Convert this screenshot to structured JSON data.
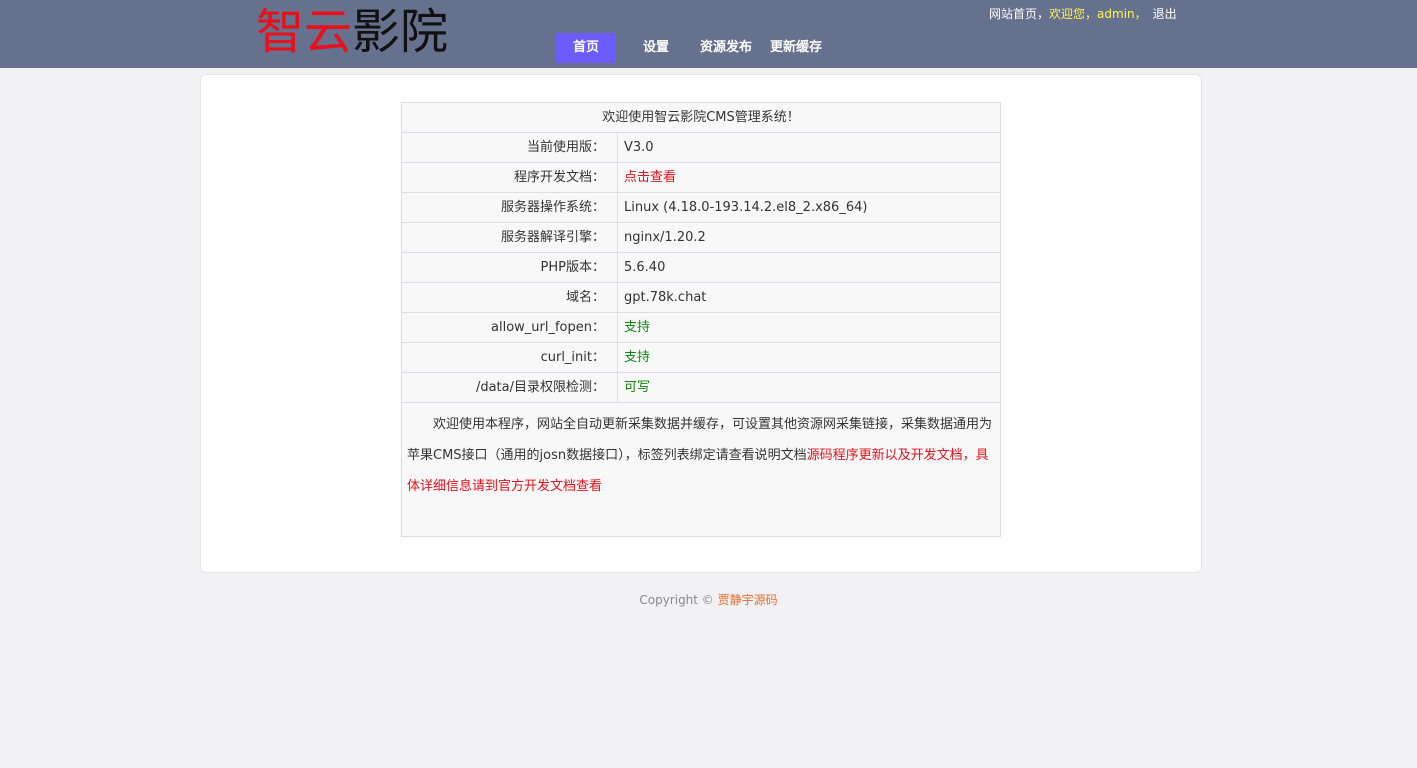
{
  "header": {
    "logo_part1": "智云",
    "logo_part2": "影院",
    "top_links": {
      "home": "网站首页，",
      "welcome": "欢迎您，",
      "user": "admin",
      "sep": "，",
      "logout": "退出"
    },
    "nav": [
      {
        "label": "首页"
      },
      {
        "label": "设置"
      },
      {
        "label": "资源发布"
      },
      {
        "label": "更新缓存"
      }
    ]
  },
  "info": {
    "welcome": "欢迎使用智云影院CMS管理系统！",
    "rows": [
      {
        "label": "当前使用版：",
        "value": "V3.0"
      },
      {
        "label": "程序开发文档：",
        "value": "点击查看"
      },
      {
        "label": "服务器操作系统：",
        "value": "Linux (4.18.0-193.14.2.el8_2.x86_64)"
      },
      {
        "label": "服务器解译引擎：",
        "value": "nginx/1.20.2"
      },
      {
        "label": "PHP版本：",
        "value": "5.6.40"
      },
      {
        "label": "域名：",
        "value": "gpt.78k.chat"
      },
      {
        "label": "allow_url_fopen：",
        "value": "支持"
      },
      {
        "label": "curl_init：",
        "value": "支持"
      },
      {
        "label": "/data/目录权限检测：",
        "value": "可写"
      }
    ],
    "desc_normal": "欢迎使用本程序，网站全自动更新采集数据并缓存，可设置其他资源网采集链接，采集数据通用为苹果CMS接口（通用的josn数据接口），标签列表绑定请查看说明文档",
    "desc_link": "源码程序更新以及开发文档，具体详细信息请到官方开发文档查看"
  },
  "footer": {
    "copyright": "Copyright © ",
    "brand": "贾静宇源码"
  },
  "colors": {
    "header_bg": "#66718d",
    "nav_active": "#6a5cff",
    "red": "#e8101a",
    "green": "#118811",
    "brand": "#e56b2b"
  }
}
